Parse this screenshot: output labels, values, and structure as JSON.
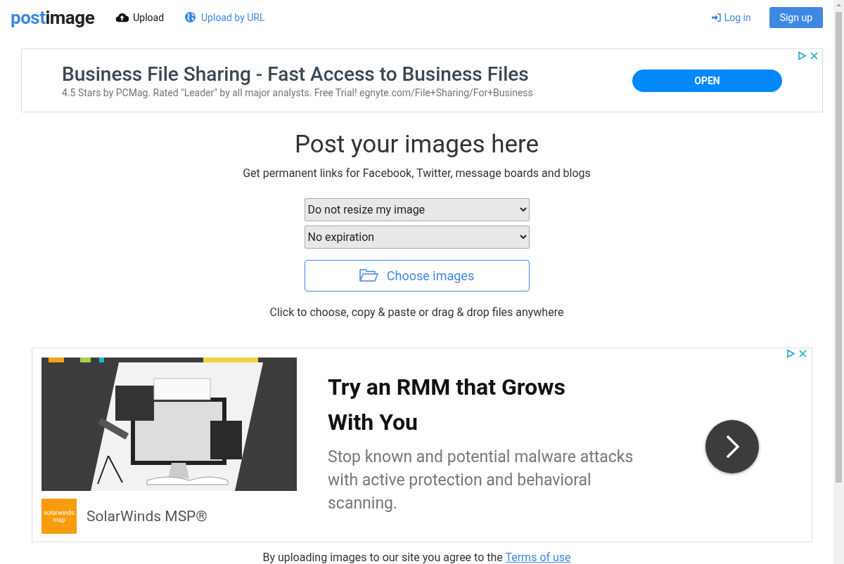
{
  "header": {
    "logo": {
      "part_1": "post",
      "part_2": "image"
    },
    "nav": [
      {
        "label": "Upload",
        "kind": "upload",
        "selected": true
      },
      {
        "label": "Upload by URL",
        "kind": "url",
        "selected": false
      }
    ],
    "login": "Log in",
    "signup": "Sign up"
  },
  "top_ad": {
    "title": "Business File Sharing - Fast Access to Business Files",
    "text": "4.5 Stars by PCMag. Rated \"Leader\" by all major analysts. Free Trial! egnyte.com/File+Sharing/For+Business",
    "button": "OPEN"
  },
  "main": {
    "title": "Post your images here",
    "subtitle": "Get permanent links for Facebook, Twitter, message boards and blogs",
    "selects": [
      {
        "value": "Do not resize my image"
      },
      {
        "value": "No expiration"
      }
    ],
    "choose_button": "Choose images",
    "hint": "Click to choose, copy & paste or drag & drop files anywhere"
  },
  "bottom_ad": {
    "brand_logo_text": "solarwinds msp",
    "brand": "SolarWinds MSP®",
    "title": "Try an RMM that Grows With You",
    "text": "Stop known and potential malware attacks with active protection and behavioral scanning."
  },
  "footer": {
    "text": "By uploading images to our site you agree to the",
    "link": "Terms of use"
  }
}
